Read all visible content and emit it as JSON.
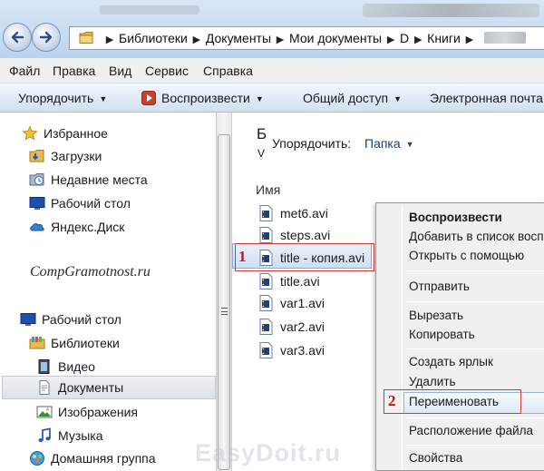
{
  "address_bar": {
    "crumbs": [
      "Библиотеки",
      "Документы",
      "Мои документы",
      "D",
      "Книги"
    ]
  },
  "menu": [
    "Файл",
    "Правка",
    "Вид",
    "Сервис",
    "Справка"
  ],
  "toolbar": {
    "organize": "Упорядочить",
    "play": "Воспроизвести",
    "share": "Общий доступ",
    "email": "Электронная почта"
  },
  "nav": {
    "favorites": "Избранное",
    "downloads": "Загрузки",
    "recent": "Недавние места",
    "desktop_fav": "Рабочий стол",
    "yandex": "Яндекс.Диск",
    "watermark": "CompGramotnost.ru",
    "desktop": "Рабочий стол",
    "libraries": "Библиотеки",
    "video": "Видео",
    "documents": "Документы",
    "images": "Изображения",
    "music": "Музыка",
    "homegroup": "Домашняя группа"
  },
  "content": {
    "lib_letter_1": "Б",
    "lib_letter_2": "V",
    "arrange_label": "Упорядочить:",
    "arrange_value": "Папка",
    "column_name": "Имя",
    "files": [
      "met6.avi",
      "steps.avi",
      "title - копия.avi",
      "title.avi",
      "var1.avi",
      "var2.avi",
      "var3.avi"
    ]
  },
  "context_menu": {
    "play": "Воспроизвести",
    "add_to_list": "Добавить в список воспр",
    "open_with": "Открыть с помощью",
    "send_to": "Отправить",
    "cut": "Вырезать",
    "copy": "Копировать",
    "create_shortcut": "Создать ярлык",
    "delete": "Удалить",
    "rename": "Переименовать",
    "file_location": "Расположение файла",
    "properties": "Свойства"
  },
  "callouts": {
    "one": "1",
    "two": "2"
  },
  "watermark_site": "EasyDoit.ru",
  "colors": {
    "accent_red": "#c0151b",
    "selection_blue": "#cfdff5"
  }
}
